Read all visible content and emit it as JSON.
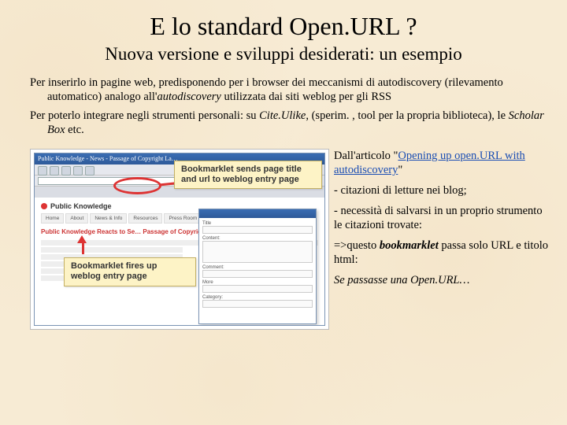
{
  "title": "E lo standard Open.URL ?",
  "subtitle": "Nuova versione e sviluppi desiderati: un esempio",
  "para1_a": "Per inserirlo in pagine web, predisponendo per i browser dei meccanismi di autodiscovery (rilevamento automatico) analogo all'",
  "para1_em": "autodiscovery",
  "para1_b": " utilizzata dai siti weblog per gli RSS",
  "para2_a": "Per poterlo integrare negli strumenti personali: su ",
  "para2_em1": "Cite.Ulike",
  "para2_b": ", (sperim. , tool per la propria biblioteca), le ",
  "para2_em2": "Scholar Box",
  "para2_c": " etc.",
  "screenshot": {
    "browser_title": "Public Knowledge - News - Passage of Copyright La…",
    "callout1": "Bookmarklet sends page title and url to weblog entry page",
    "callout2": "Bookmarklet fires up weblog entry page",
    "pk_brand": "Public Knowledge",
    "nav": [
      "Home",
      "About",
      "News & Info",
      "Resources",
      "Press Room"
    ],
    "news_headline": "Public Knowledge Reacts to Se… Passage of Copyright Legislation",
    "popup_fields": [
      "Title",
      "Content:",
      "Comment:",
      "More",
      "Category:"
    ]
  },
  "right": {
    "r1_a": "Dall'articolo \"",
    "r1_link": "Opening up open.URL with autodiscovery",
    "r1_b": "\"",
    "r2": "- citazioni di letture nei blog;",
    "r3": "- necessità di salvarsi in un proprio strumento le citazioni trovate:",
    "r4_a": "=>questo ",
    "r4_b": "bookmarklet",
    "r4_c": " passa solo URL e titolo html:",
    "r5_a": "Se passasse una Open.URL…"
  }
}
